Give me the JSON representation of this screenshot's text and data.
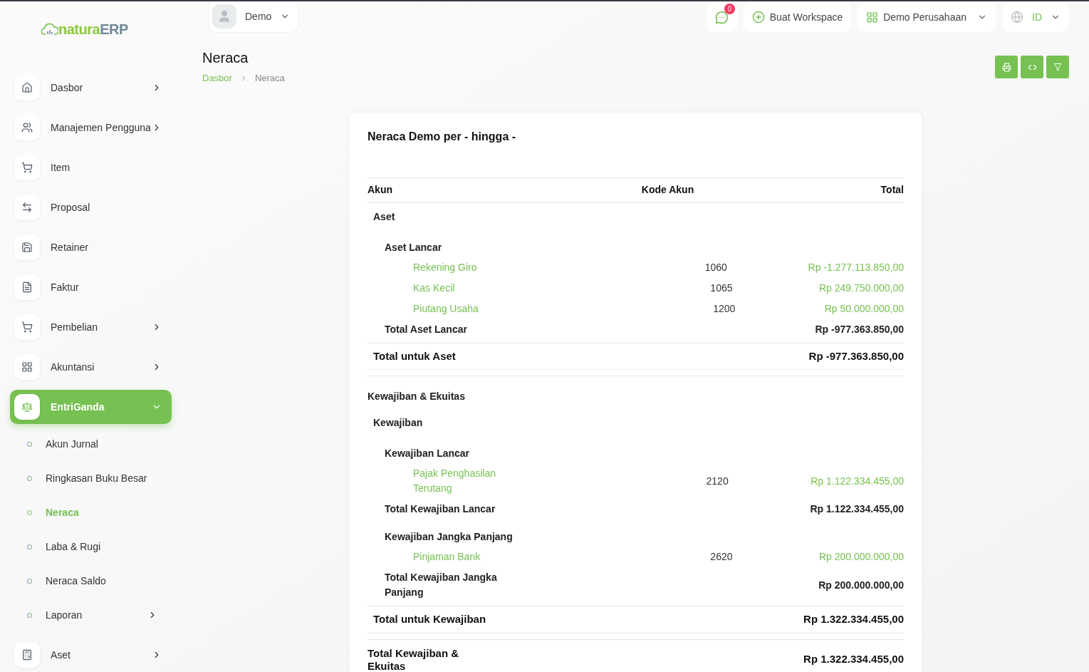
{
  "brand": {
    "part1": "natura",
    "part2": "ERP"
  },
  "user_menu": {
    "label": "Demo"
  },
  "header": {
    "chat_badge": "0",
    "workspace_button": "Buat Workspace",
    "company": "Demo Perusahaan",
    "language": "ID"
  },
  "sidebar": {
    "items": [
      {
        "label": "Dasbor",
        "expanded": false,
        "selected": false
      },
      {
        "label": "Manajemen Pengguna",
        "expanded": false,
        "selected": false
      },
      {
        "label": "Item",
        "selected": false
      },
      {
        "label": "Proposal",
        "selected": false
      },
      {
        "label": "Retainer",
        "selected": false
      },
      {
        "label": "Faktur",
        "selected": false
      },
      {
        "label": "Pembelian",
        "expanded": false,
        "selected": false
      },
      {
        "label": "Akuntansi",
        "expanded": false,
        "selected": false
      },
      {
        "label": "EntriGanda",
        "expanded": true,
        "selected": true,
        "children": [
          {
            "label": "Akun Jurnal",
            "selected": false
          },
          {
            "label": "Ringkasan Buku Besar",
            "selected": false
          },
          {
            "label": "Neraca",
            "selected": true
          },
          {
            "label": "Laba & Rugi",
            "selected": false
          },
          {
            "label": "Neraca Saldo",
            "selected": false
          },
          {
            "label": "Laporan",
            "selected": false,
            "expanded": false
          }
        ]
      },
      {
        "label": "Aset",
        "expanded": false,
        "selected": false
      }
    ]
  },
  "page": {
    "title": "Neraca",
    "breadcrumb": [
      "Dasbor",
      "Neraca"
    ]
  },
  "report": {
    "title": "Neraca Demo per - hingga -",
    "columns": [
      "Akun",
      "Kode Akun",
      "Total"
    ],
    "rows": [
      {
        "kind": "group",
        "account": "Aset"
      },
      {
        "kind": "subgroup",
        "account": "Aset Lancar"
      },
      {
        "kind": "account",
        "account": "Rekening Giro",
        "code": "1060",
        "total": "Rp -1.277.113.850,00"
      },
      {
        "kind": "account",
        "account": "Kas Kecil",
        "code": "1065",
        "total": "Rp 249.750.000,00"
      },
      {
        "kind": "account",
        "account": "Piutang Usaha",
        "code": "1200",
        "total": "Rp 50.000.000,00"
      },
      {
        "kind": "subtotal",
        "account": "Total Aset Lancar",
        "total": "Rp -977.363.850,00"
      },
      {
        "kind": "total",
        "account": "Total untuk Aset",
        "total": "Rp -977.363.850,00"
      },
      {
        "kind": "section",
        "account": "Kewajiban & Ekuitas"
      },
      {
        "kind": "group",
        "account": "Kewajiban"
      },
      {
        "kind": "subgroup",
        "account": "Kewajiban Lancar"
      },
      {
        "kind": "account",
        "account": "Pajak Penghasilan Terutang",
        "code": "2120",
        "total": "Rp 1.122.334.455,00"
      },
      {
        "kind": "subtotal",
        "account": "Total Kewajiban Lancar",
        "total": "Rp 1.122.334.455,00"
      },
      {
        "kind": "subgroup",
        "account": "Kewajiban Jangka Panjang"
      },
      {
        "kind": "account",
        "account": "Pinjaman Bank",
        "code": "2620",
        "total": "Rp 200.000.000,00"
      },
      {
        "kind": "subtotal",
        "account": "Total Kewajiban Jangka Panjang",
        "total": "Rp 200.000.000,00"
      },
      {
        "kind": "total",
        "account": "Total untuk Kewajiban",
        "total": "Rp 1.322.334.455,00"
      },
      {
        "kind": "grand_total",
        "account": "Total Kewajiban & Ekuitas",
        "total": "Rp 1.322.334.455,00"
      }
    ]
  }
}
